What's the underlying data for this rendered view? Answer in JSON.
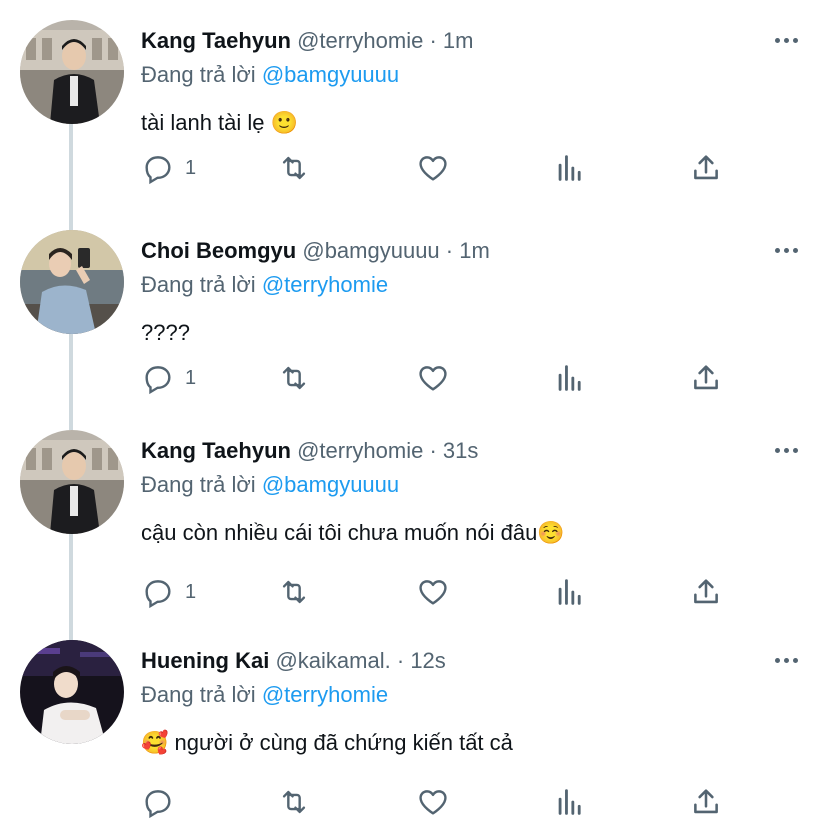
{
  "colors": {
    "text": "#0f1419",
    "secondary": "#536471",
    "link": "#1d9bf0",
    "thread_line": "#cfd9de"
  },
  "icons": {
    "reply": "speech-bubble-icon",
    "retweet": "retweet-arrows-icon",
    "like": "heart-outline-icon",
    "analytics": "bar-chart-icon",
    "share": "upload-arrow-icon",
    "more": "three-dots-icon"
  },
  "tweets": [
    {
      "name": "Kang Taehyun",
      "handle": "@terryhomie",
      "separator": "·",
      "time": "1m",
      "reply_prefix": "Đang trả lời",
      "reply_to": "@bamgyuuuu",
      "text": "tài lanh tài lẹ 🙂",
      "reply_count": "1"
    },
    {
      "name": "Choi Beomgyu",
      "handle": "@bamgyuuuu",
      "separator": "·",
      "time": "1m",
      "reply_prefix": "Đang trả lời",
      "reply_to": "@terryhomie",
      "text": "????",
      "reply_count": "1"
    },
    {
      "name": "Kang Taehyun",
      "handle": "@terryhomie",
      "separator": "·",
      "time": "31s",
      "reply_prefix": "Đang trả lời",
      "reply_to": "@bamgyuuuu",
      "text": "cậu còn nhiều cái tôi chưa muốn nói đâu☺️",
      "reply_count": "1"
    },
    {
      "name": "Huening Kai",
      "handle": "@kaikamal.",
      "separator": "·",
      "time": "12s",
      "reply_prefix": "Đang trả lời",
      "reply_to": "@terryhomie",
      "text": "🥰  người ở cùng đã chứng kiến tất cả",
      "reply_count": ""
    }
  ]
}
